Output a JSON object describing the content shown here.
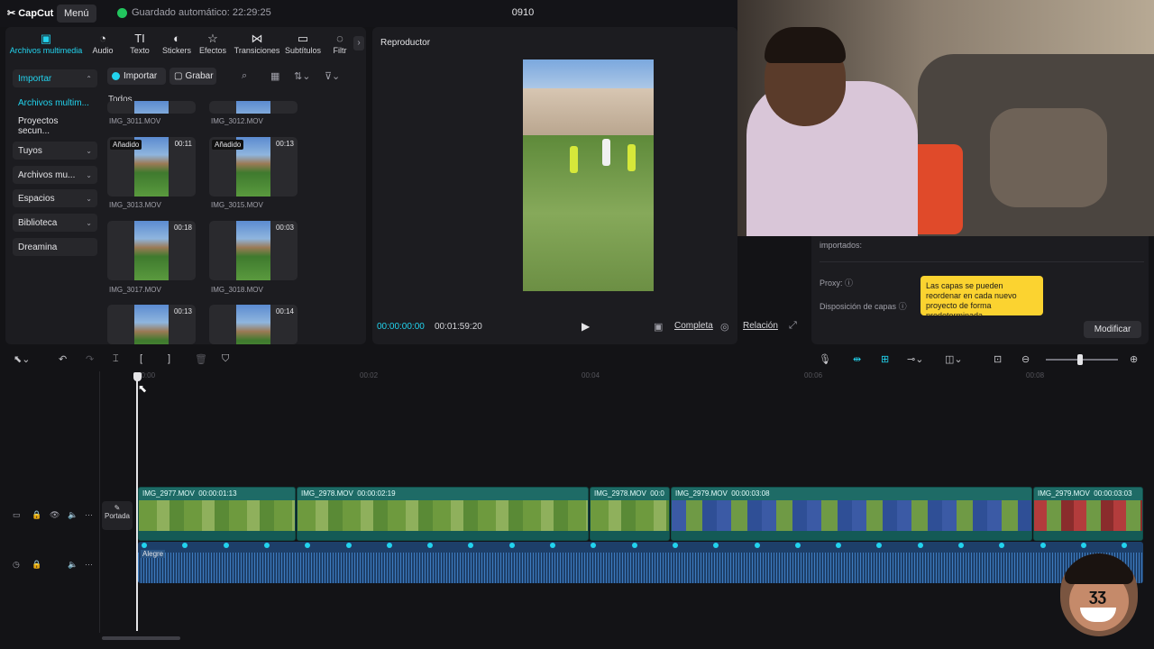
{
  "app": {
    "logo": "CapCut",
    "menu_label": "Menú",
    "autosave": "Guardado automático: 22:29:25",
    "project_name": "0910"
  },
  "tabs": [
    {
      "label": "Archivos multimedia",
      "icon": "media-icon"
    },
    {
      "label": "Audio",
      "icon": "audio-icon"
    },
    {
      "label": "Texto",
      "icon": "text-icon"
    },
    {
      "label": "Stickers",
      "icon": "sticker-icon"
    },
    {
      "label": "Efectos",
      "icon": "effects-icon"
    },
    {
      "label": "Transiciones",
      "icon": "transitions-icon"
    },
    {
      "label": "Subtítulos",
      "icon": "subtitles-icon"
    },
    {
      "label": "Filtr",
      "icon": "filters-icon"
    }
  ],
  "sidebar": {
    "items": [
      {
        "label": "Importar"
      },
      {
        "label": "Archivos multim..."
      },
      {
        "label": "Proyectos secun..."
      },
      {
        "label": "Tuyos"
      },
      {
        "label": "Archivos mu..."
      },
      {
        "label": "Espacios"
      },
      {
        "label": "Biblioteca"
      },
      {
        "label": "Dreamina"
      }
    ]
  },
  "media": {
    "import_label": "Importar",
    "record_label": "Grabar",
    "filter_label": "Todos",
    "added_badge": "Añadido",
    "files": [
      {
        "name": "IMG_3011.MOV",
        "duration": ""
      },
      {
        "name": "IMG_3012.MOV",
        "duration": ""
      },
      {
        "name": "IMG_3013.MOV",
        "duration": "00:11"
      },
      {
        "name": "IMG_3015.MOV",
        "duration": "00:13"
      },
      {
        "name": "IMG_3017.MOV",
        "duration": "00:18"
      },
      {
        "name": "IMG_3018.MOV",
        "duration": "00:03"
      },
      {
        "name": "",
        "duration": "00:13"
      },
      {
        "name": "",
        "duration": "00:14"
      }
    ]
  },
  "player": {
    "title": "Reproductor",
    "current_time": "00:00:00:00",
    "total_time": "00:01:59:20",
    "full_label": "Completa",
    "ratio_label": "Relación"
  },
  "details": {
    "imported_label": "importados:",
    "proxy_label": "Proxy:",
    "layers_label": "Disposición de capas",
    "tooltip": "Las capas se pueden reordenar en cada nuevo proyecto de forma predeterminada.",
    "modify_button": "Modificar"
  },
  "timeline": {
    "ruler": [
      "00:00",
      "00:02",
      "00:04",
      "00:06",
      "00:08"
    ],
    "cover_label": "Portada",
    "clips": [
      {
        "name": "IMG_2977.MOV",
        "duration": "00:00:01:13"
      },
      {
        "name": "IMG_2978.MOV",
        "duration": "00:00:02:19"
      },
      {
        "name": "IMG_2978.MOV",
        "duration": "00:0"
      },
      {
        "name": "IMG_2979.MOV",
        "duration": "00:00:03:08"
      },
      {
        "name": "IMG_2979.MOV",
        "duration": "00:00:03:03"
      }
    ],
    "audio_label": "Alegre"
  },
  "colors": {
    "accent": "#22d3ee",
    "clip": "#1e6b66",
    "audio": "#1d3f69",
    "tooltip": "#fbd330"
  }
}
